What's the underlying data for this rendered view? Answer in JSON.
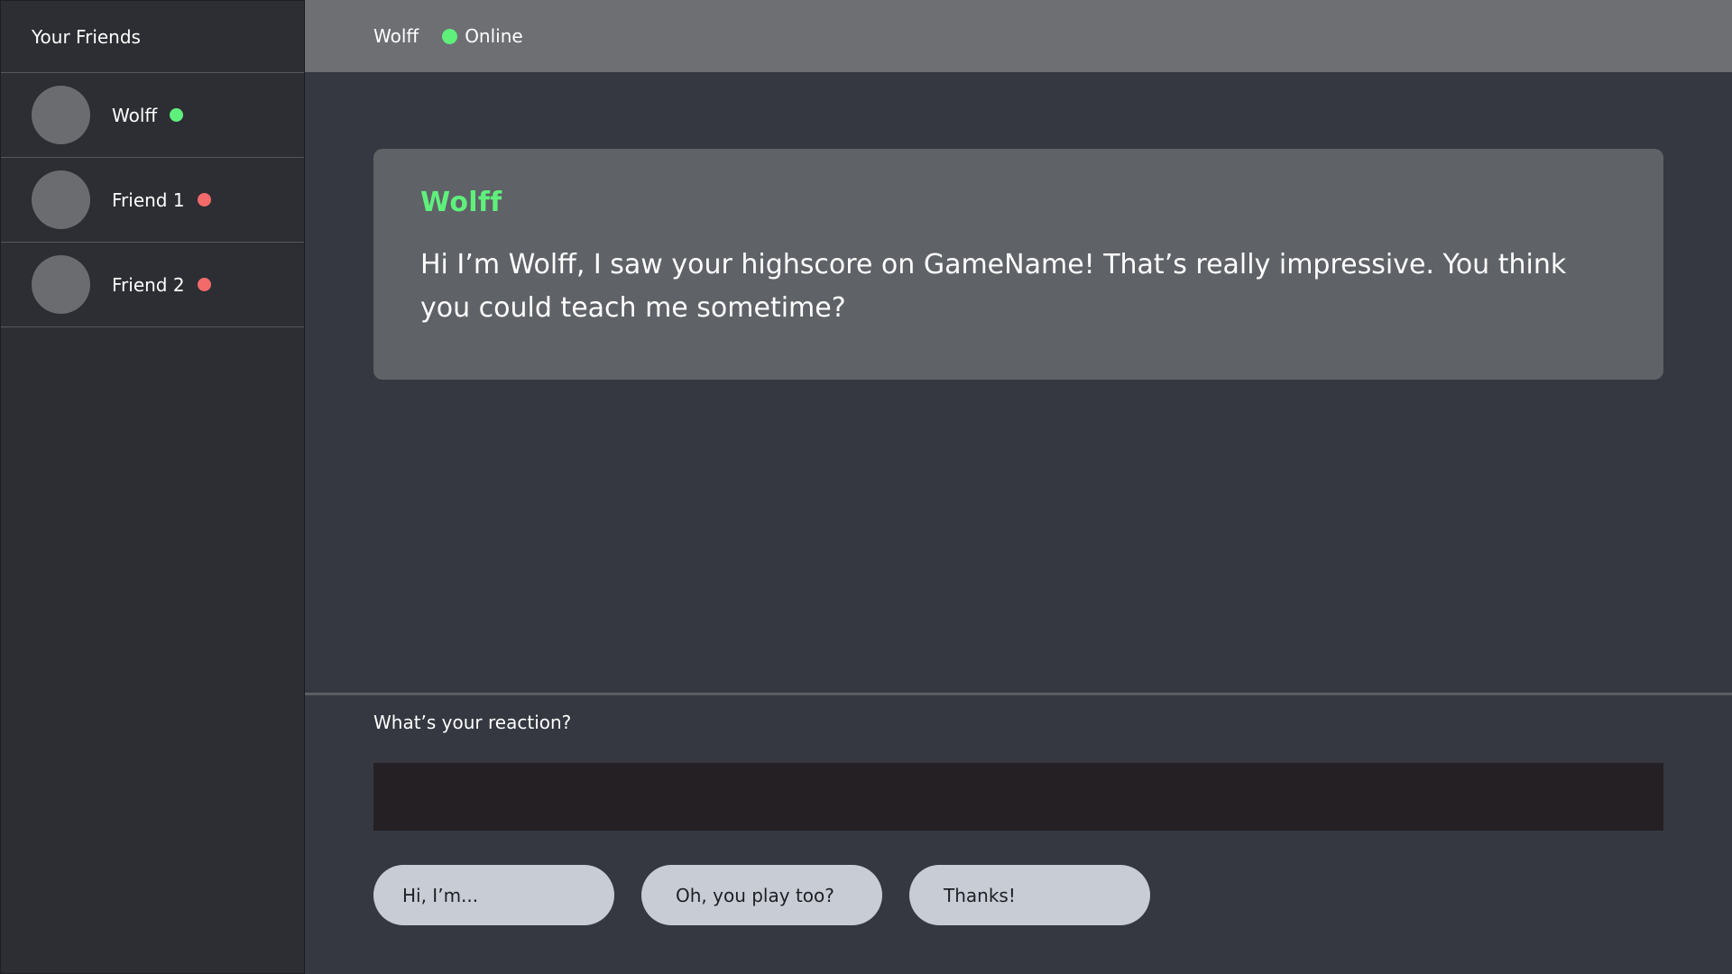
{
  "sidebar": {
    "title": "Your Friends",
    "friends": [
      {
        "name": "Wolff",
        "status": "online",
        "status_color": "#5ff07c"
      },
      {
        "name": "Friend 1",
        "status": "offline",
        "status_color": "#f26a6a"
      },
      {
        "name": "Friend 2",
        "status": "offline",
        "status_color": "#f26a6a"
      }
    ]
  },
  "topbar": {
    "name": "Wolff",
    "status_text": "Online",
    "status_color": "#5ff07c"
  },
  "chat": {
    "messages": [
      {
        "sender": "Wolff",
        "sender_color": "#5ff07c",
        "text": "Hi I’m Wolff, I saw your highscore on GameName! That’s really impressive. You think you could teach me sometime?"
      }
    ]
  },
  "reaction": {
    "prompt": "What’s your reaction?",
    "input_value": "",
    "quick_replies": [
      "Hi, I’m...",
      "Oh, you play too?",
      "Thanks!"
    ]
  },
  "colors": {
    "background": "#353840",
    "sidebar": "#2c2e33",
    "topbar": "#6d6f73",
    "message_bubble": "#5f6267",
    "input": "#242024",
    "quick_reply": "#c8ccd4",
    "online": "#5ff07c",
    "offline": "#f26a6a"
  }
}
